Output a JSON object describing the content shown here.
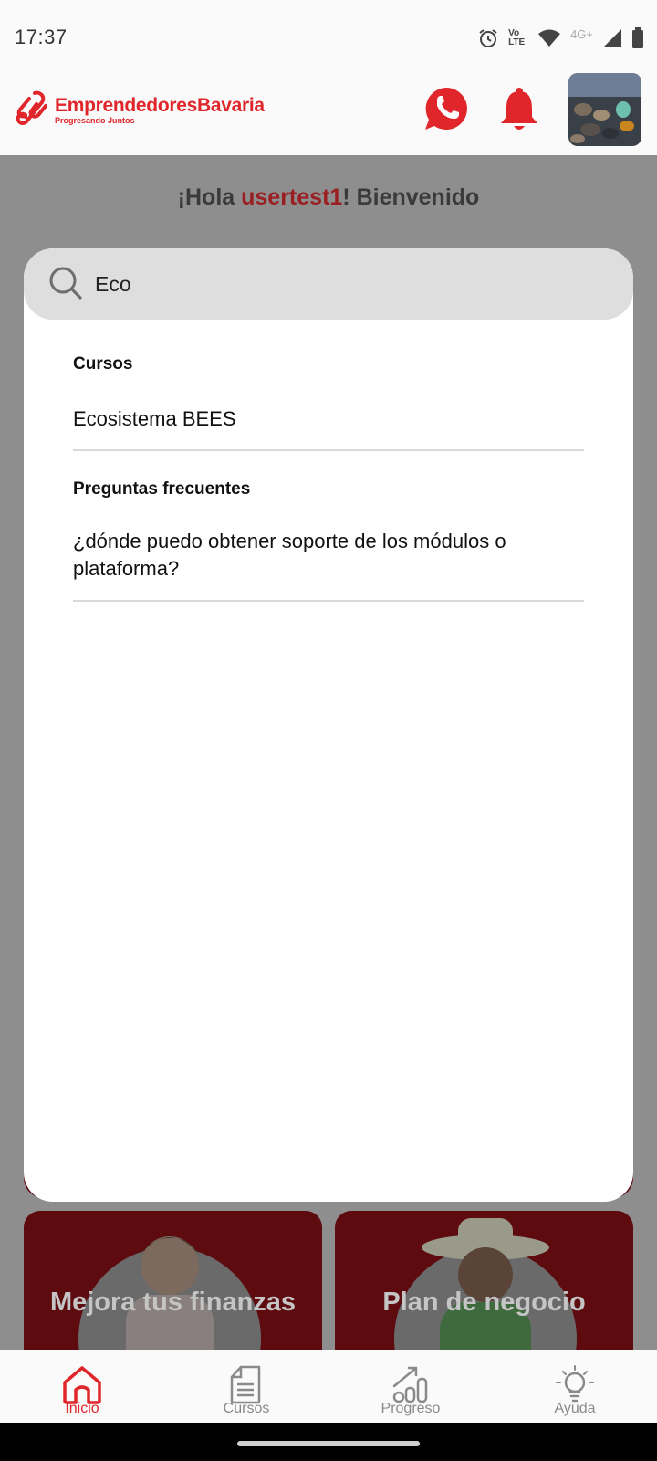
{
  "status": {
    "time": "17:37",
    "network": "4G+",
    "volte": "Vo LTE"
  },
  "header": {
    "logo_name": "EmprendedoresBavaria",
    "logo_tagline": "Progresando Juntos",
    "whatsapp_icon": "whatsapp-icon",
    "bell_icon": "bell-icon",
    "brand_color": "#e0262b"
  },
  "greeting": {
    "prefix": "¡Hola ",
    "username": "usertest1",
    "suffix": "! Bienvenido"
  },
  "search": {
    "value": "Eco",
    "placeholder": ""
  },
  "results": {
    "courses_title": "Cursos",
    "courses": [
      "Ecosistema BEES"
    ],
    "faq_title": "Preguntas frecuentes",
    "faqs": [
      "¿dónde puedo obtener soporte de los módulos o plataforma?"
    ]
  },
  "cards": {
    "left_title": "Mejora tus finanzas",
    "right_title": "Plan de negocio"
  },
  "nav": {
    "items": [
      {
        "label": "Inicio",
        "icon": "home-icon",
        "active": true
      },
      {
        "label": "Cursos",
        "icon": "document-icon",
        "active": false
      },
      {
        "label": "Progreso",
        "icon": "chart-icon",
        "active": false
      },
      {
        "label": "Ayuda",
        "icon": "lightbulb-icon",
        "active": false
      }
    ]
  }
}
